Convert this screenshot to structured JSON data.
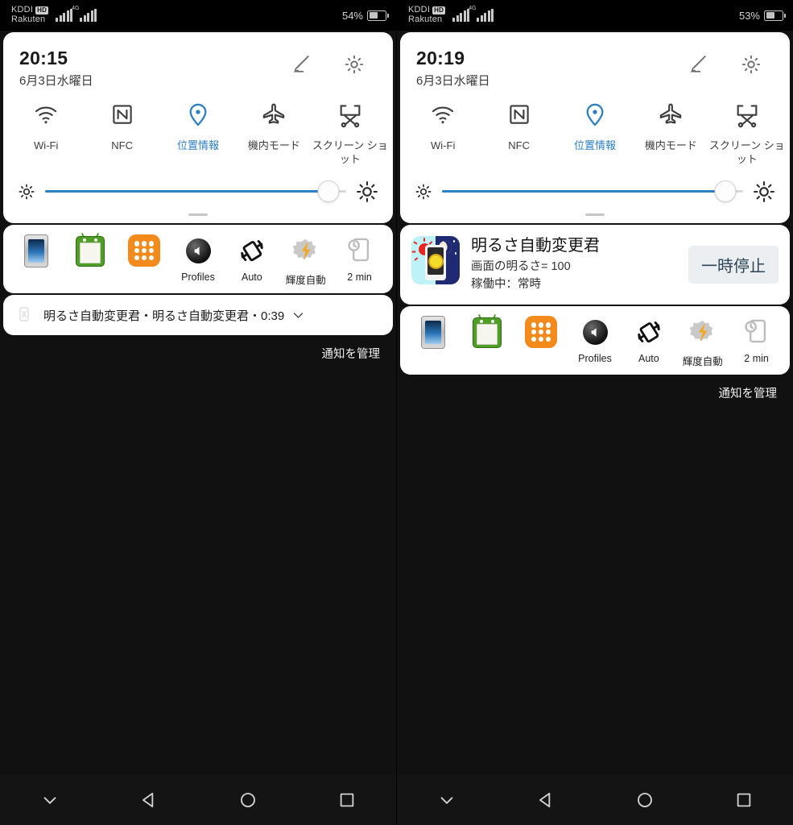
{
  "meta": {
    "accent_blue": "#2d7fc4",
    "panel_bg": "#ffffff",
    "screen_bg": "#111111"
  },
  "panels": [
    {
      "id": "left",
      "statusbar": {
        "carrier_line1": "KDDI",
        "hd_badge": "HD",
        "carrier_line2": "Rakuten",
        "network_label": "4G",
        "battery_percent": "54%",
        "battery_level": 54
      },
      "quick_settings": {
        "time": "20:15",
        "date": "6月3日水曜日",
        "edit_icon": "pencil-icon",
        "settings_icon": "gear-icon",
        "toggles": [
          {
            "label": "Wi-Fi",
            "icon": "wifi-icon",
            "active": false
          },
          {
            "label": "NFC",
            "icon": "nfc-icon",
            "active": false
          },
          {
            "label": "位置情報",
            "icon": "location-pin-icon",
            "active": true
          },
          {
            "label": "機内モード",
            "icon": "airplane-icon",
            "active": false
          },
          {
            "label": "スクリーン\nショット",
            "icon": "screenshot-icon",
            "active": false
          }
        ],
        "brightness": {
          "value": 94,
          "low_icon": "sun-small-icon",
          "high_icon": "sun-large-icon"
        }
      },
      "shortcuts": [
        {
          "icon": "device-screen-icon",
          "label": ""
        },
        {
          "icon": "android-clipboard-icon",
          "label": ""
        },
        {
          "icon": "app-drawer-icon",
          "label": ""
        },
        {
          "icon": "volume-profiles-icon",
          "label": "Profiles"
        },
        {
          "icon": "auto-rotate-icon",
          "label": "Auto"
        },
        {
          "icon": "tasker-brightness-icon",
          "label": "輝度自動"
        },
        {
          "icon": "screen-timeout-icon",
          "label": "2 min"
        }
      ],
      "notification": {
        "type": "collapsed",
        "icon": "app-mini-icon",
        "text": "明るさ自動変更君・明るさ自動変更君・0:39",
        "expand_icon": "chevron-down-icon"
      },
      "manage_label": "通知を管理"
    },
    {
      "id": "right",
      "statusbar": {
        "carrier_line1": "KDDI",
        "hd_badge": "HD",
        "carrier_line2": "Rakuten",
        "network_label": "4G",
        "battery_percent": "53%",
        "battery_level": 53
      },
      "quick_settings": {
        "time": "20:19",
        "date": "6月3日水曜日",
        "edit_icon": "pencil-icon",
        "settings_icon": "gear-icon",
        "toggles": [
          {
            "label": "Wi-Fi",
            "icon": "wifi-icon",
            "active": false
          },
          {
            "label": "NFC",
            "icon": "nfc-icon",
            "active": false
          },
          {
            "label": "位置情報",
            "icon": "location-pin-icon",
            "active": true
          },
          {
            "label": "機内モード",
            "icon": "airplane-icon",
            "active": false
          },
          {
            "label": "スクリーン\nショット",
            "icon": "screenshot-icon",
            "active": false
          }
        ],
        "brightness": {
          "value": 94,
          "low_icon": "sun-small-icon",
          "high_icon": "sun-large-icon"
        }
      },
      "shortcuts": [
        {
          "icon": "device-screen-icon",
          "label": ""
        },
        {
          "icon": "android-clipboard-icon",
          "label": ""
        },
        {
          "icon": "app-drawer-icon",
          "label": ""
        },
        {
          "icon": "volume-profiles-icon",
          "label": "Profiles"
        },
        {
          "icon": "auto-rotate-icon",
          "label": "Auto"
        },
        {
          "icon": "tasker-brightness-icon",
          "label": "輝度自動"
        },
        {
          "icon": "screen-timeout-icon",
          "label": "2 min"
        }
      ],
      "notification": {
        "type": "expanded",
        "icon": "brightness-auto-app-icon",
        "title": "明るさ自動変更君",
        "line1": "画面の明るさ= 100",
        "line2": "稼働中：常時",
        "action_label": "一時停止"
      },
      "manage_label": "通知を管理"
    }
  ],
  "navbar": {
    "buttons": [
      {
        "icon": "chevron-down-icon",
        "name": "collapse-button"
      },
      {
        "icon": "back-triangle-icon",
        "name": "back-button"
      },
      {
        "icon": "home-circle-icon",
        "name": "home-button"
      },
      {
        "icon": "recents-square-icon",
        "name": "recents-button"
      }
    ]
  }
}
